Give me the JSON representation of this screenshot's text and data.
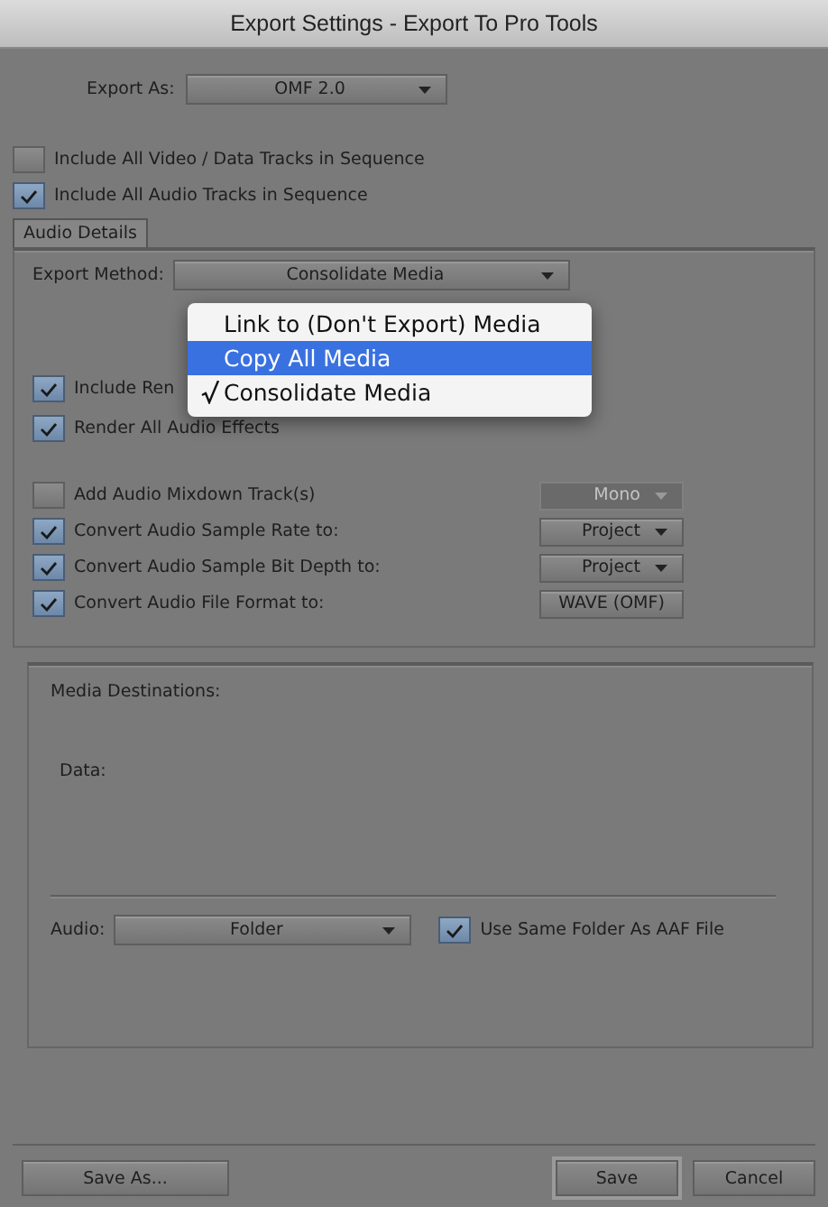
{
  "window": {
    "title": "Export Settings - Export To Pro Tools"
  },
  "export_as": {
    "label": "Export As:",
    "value": "OMF 2.0"
  },
  "track_options": [
    {
      "label": "Include All Video / Data Tracks in Sequence",
      "checked": false
    },
    {
      "label": "Include All Audio Tracks in Sequence",
      "checked": true
    }
  ],
  "tabs": [
    {
      "label": "Audio Details",
      "selected": true
    }
  ],
  "export_method": {
    "label": "Export Method:",
    "value": "Consolidate Media"
  },
  "render_options": [
    {
      "label": "Include Ren",
      "checked": true
    },
    {
      "label": "Render All Audio Effects",
      "checked": true
    }
  ],
  "audio_options": [
    {
      "label": "Add Audio Mixdown Track(s)",
      "checked": false,
      "control": {
        "kind": "dropdown",
        "value": "Mono",
        "disabled": true
      }
    },
    {
      "label": "Convert Audio Sample Rate to:",
      "checked": true,
      "control": {
        "kind": "dropdown",
        "value": "Project",
        "disabled": false
      }
    },
    {
      "label": "Convert Audio Sample Bit Depth to:",
      "checked": true,
      "control": {
        "kind": "dropdown",
        "value": "Project",
        "disabled": false
      }
    },
    {
      "label": "Convert Audio File Format to:",
      "checked": true,
      "control": {
        "kind": "button",
        "value": "WAVE (OMF)"
      }
    }
  ],
  "media_destinations": {
    "title": "Media Destinations:",
    "data_label": "Data:",
    "audio_label": "Audio:",
    "audio_value": "Folder",
    "same_folder": {
      "label": "Use Same Folder As AAF File",
      "checked": true
    }
  },
  "method_menu": [
    {
      "label": "Link to (Don't Export) Media",
      "checked": false,
      "highlighted": false
    },
    {
      "label": "Copy All Media",
      "checked": false,
      "highlighted": true
    },
    {
      "label": "Consolidate Media",
      "checked": true,
      "highlighted": false
    }
  ],
  "buttons": [
    {
      "label": "Save As...",
      "kind": "left",
      "default": false
    },
    {
      "label": "Save",
      "kind": "right",
      "default": true
    },
    {
      "label": "Cancel",
      "kind": "right",
      "default": false
    }
  ]
}
